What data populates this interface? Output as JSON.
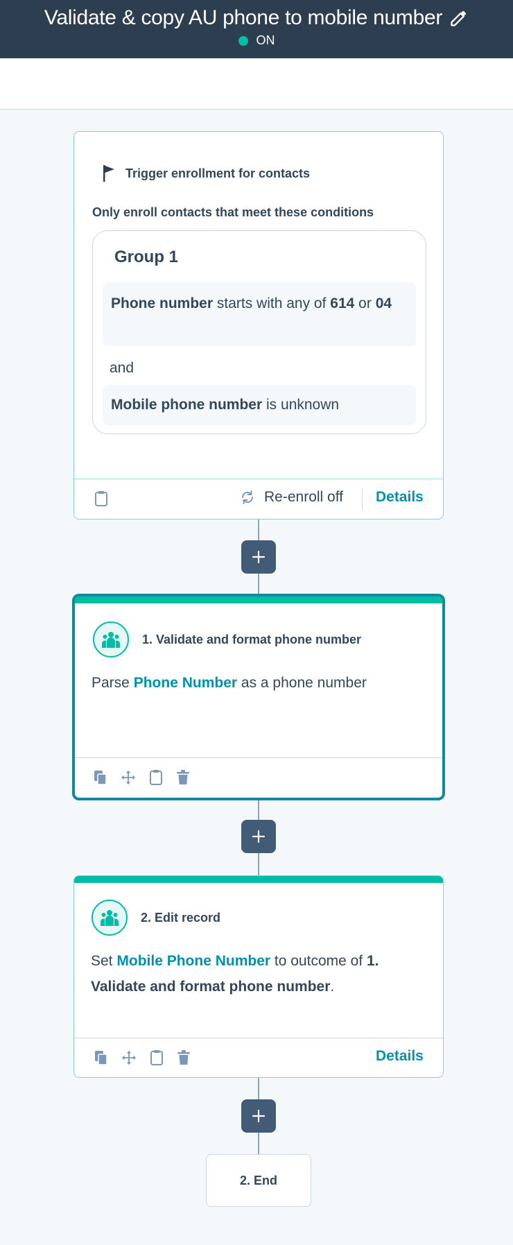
{
  "header": {
    "title": "Validate & copy AU phone to mobile number",
    "status": "ON",
    "status_color": "#00bda5"
  },
  "trigger": {
    "heading": "Trigger enrollment for contacts",
    "conditions_label": "Only enroll contacts that meet these conditions",
    "group_title": "Group 1",
    "condition1": {
      "property": "Phone number",
      "operator": "starts with any of",
      "value1": "614",
      "joiner": "or",
      "value2": "04"
    },
    "and_label": "and",
    "condition2": {
      "property": "Mobile phone number",
      "operator": "is unknown"
    },
    "reenroll_label": "Re-enroll off",
    "details_label": "Details"
  },
  "action1": {
    "title": "1. Validate and format phone number",
    "body_prefix": "Parse",
    "body_link": "Phone Number",
    "body_suffix": "as a phone number"
  },
  "action2": {
    "title": "2. Edit record",
    "body_prefix": "Set",
    "body_link": "Mobile Phone Number",
    "body_middle": "to outcome of",
    "body_bold": "1. Validate and format phone number",
    "body_end": ".",
    "details_label": "Details"
  },
  "end": {
    "label": "2. End"
  },
  "icons": {
    "edit": "pencil-icon",
    "trigger": "flag-icon",
    "note": "clipboard-icon",
    "reenroll": "sync-icon",
    "add": "plus-icon",
    "action": "contacts-icon",
    "clone": "copy-icon",
    "move": "move-icon",
    "delete": "trash-icon"
  },
  "colors": {
    "header_bg": "#2d3e50",
    "accent_teal": "#00bda5",
    "link": "#0091ae",
    "plus_button": "#425b76"
  }
}
